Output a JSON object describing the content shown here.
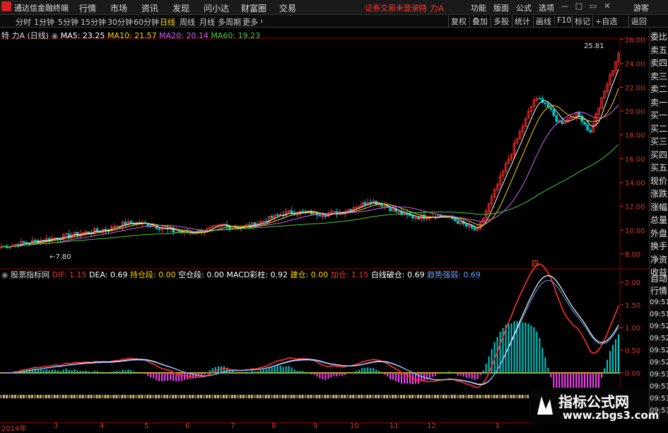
{
  "app": {
    "title": "通达信金融终端"
  },
  "menu": {
    "items": [
      "行情",
      "市场",
      "资讯",
      "发现",
      "问小达",
      "财富圈",
      "交易"
    ],
    "status_warning": "证券交易未登录",
    "stock_name": "特 力A",
    "right_items": [
      "功能",
      "版面",
      "公式",
      "选项"
    ],
    "guest": "游客"
  },
  "periods": [
    "分时",
    "1分钟",
    "5分钟",
    "15分钟",
    "30分钟",
    "60分钟",
    "日线",
    "周线",
    "月线",
    "多周期",
    "更多"
  ],
  "active_period": "日线",
  "tools": [
    "复权",
    "叠加",
    "多股",
    "统计",
    "画线",
    "F10",
    "标记",
    "+自选",
    "返回"
  ],
  "price_panel": {
    "stock_label": "特 力A (日线)",
    "ma": [
      {
        "label": "MA5: 23.25",
        "color": "#ffffff"
      },
      {
        "label": "MA10: 21.57",
        "color": "#ffd400"
      },
      {
        "label": "MA20: 20.14",
        "color": "#d060ff"
      },
      {
        "label": "MA60: 19.23",
        "color": "#40d040"
      }
    ],
    "y_ticks": [
      "26.00",
      "24.00",
      "22.00",
      "20.00",
      "18.00",
      "16.00",
      "14.00",
      "12.00",
      "10.00",
      "8.00"
    ],
    "high_label": "25.81",
    "low_label": "7.80",
    "marker": "四"
  },
  "indicator_panel": {
    "name": "股票指标网",
    "items": [
      {
        "label": "DIF: 1.15",
        "color": "#ff3030"
      },
      {
        "label": "DEA: 0.69",
        "color": "#ffffff"
      },
      {
        "label": "持仓段: 0.00",
        "color": "#ffd400"
      },
      {
        "label": "空仓段: 0.00",
        "color": "#ffffff"
      },
      {
        "label": "MACD彩柱: 0.92",
        "color": "#ffffff"
      },
      {
        "label": "建仓: 0.00",
        "color": "#ffd400"
      },
      {
        "label": "加仓: 1.15",
        "color": "#ff3030"
      },
      {
        "label": "白线破仓: 0.69",
        "color": "#ffffff"
      },
      {
        "label": "趋势强弱: 0.69",
        "color": "#6aa0ff"
      }
    ],
    "y_ticks": [
      "2.00",
      "1.50",
      "1.00",
      "0.50",
      "0.00"
    ],
    "marker_text": "仓"
  },
  "right_panel_top": [
    "委比",
    "卖五",
    "卖四",
    "卖三",
    "卖二",
    "卖一",
    "买一",
    "买二",
    "买三",
    "买四",
    "买五",
    "现价",
    "涨跌",
    "涨幅",
    "总量",
    "外盘",
    "换手",
    "净资",
    "收益"
  ],
  "right_panel_bottom": [
    "自动",
    "行情",
    "09:51",
    "09:51",
    "09:52",
    "09:52",
    "09:52",
    "09:52",
    "09:53",
    "09:53",
    "09:53",
    "09:53"
  ],
  "date_axis": {
    "year": "2014年",
    "months": [
      "3",
      "4",
      "5",
      "6",
      "7",
      "8",
      "9",
      "10",
      "11",
      "12",
      "3"
    ]
  },
  "watermark": {
    "line1": "指标公式网",
    "line2": "www.zbgs3.com"
  },
  "colors": {
    "up": "#ff3030",
    "down": "#00c0c0",
    "accent": "#ffd400",
    "background": "#000000"
  }
}
